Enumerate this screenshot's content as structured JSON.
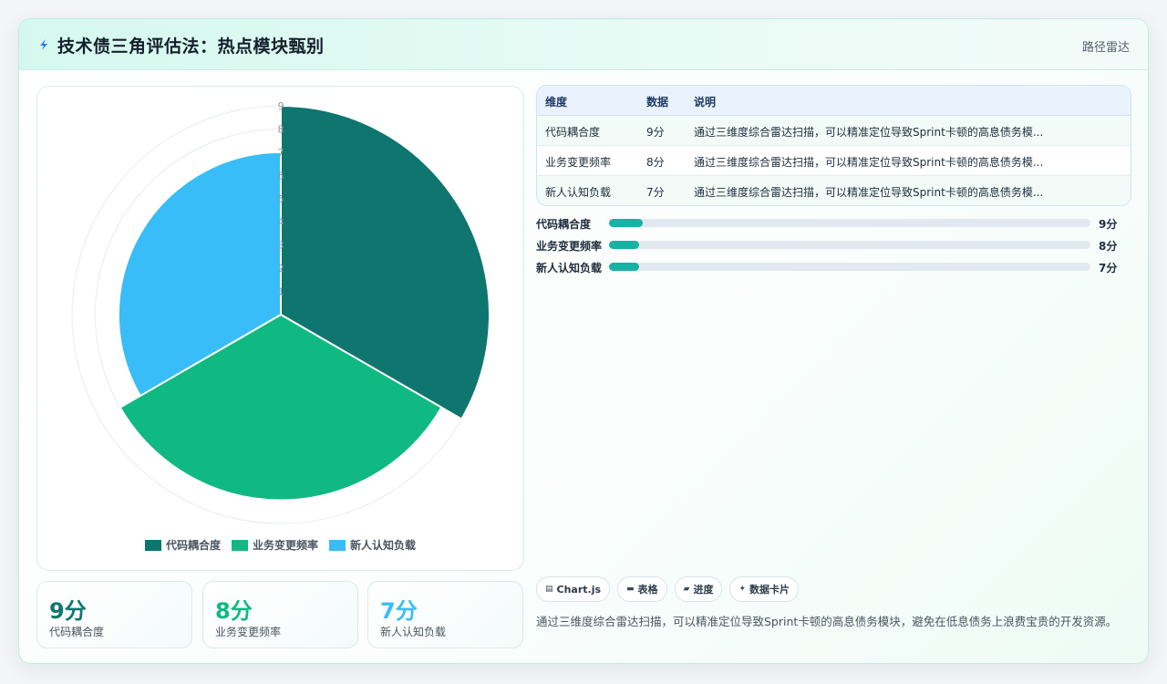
{
  "header": {
    "title": "技术债三角评估法：热点模块甄别",
    "link": "路径雷达",
    "bolt_color": "#2a7de1"
  },
  "chart_data": {
    "type": "polarArea",
    "categories": [
      "代码耦合度",
      "业务变更频率",
      "新人认知负载"
    ],
    "values": [
      9,
      8,
      7
    ],
    "colors": [
      "#0e766e",
      "#10b981",
      "#38bdf8"
    ],
    "rlim": [
      0,
      9
    ],
    "ticks": [
      1,
      2,
      3,
      4,
      5,
      6,
      7,
      8,
      9
    ],
    "legend_position": "bottom"
  },
  "stats": [
    {
      "value": "9分",
      "label": "代码耦合度",
      "color": "#0e766e"
    },
    {
      "value": "8分",
      "label": "业务变更频率",
      "color": "#10b981"
    },
    {
      "value": "7分",
      "label": "新人认知负载",
      "color": "#38bdf8"
    }
  ],
  "table": {
    "headers": [
      "维度",
      "数据",
      "说明"
    ],
    "rows": [
      [
        "代码耦合度",
        "9分",
        "通过三维度综合雷达扫描，可以精准定位导致Sprint卡顿的高息债务模..."
      ],
      [
        "业务变更频率",
        "8分",
        "通过三维度综合雷达扫描，可以精准定位导致Sprint卡顿的高息债务模..."
      ],
      [
        "新人认知负载",
        "7分",
        "通过三维度综合雷达扫描，可以精准定位导致Sprint卡顿的高息债务模..."
      ]
    ]
  },
  "progress": [
    {
      "label": "代码耦合度",
      "value": "9分",
      "fraction": 0.07
    },
    {
      "label": "业务变更频率",
      "value": "8分",
      "fraction": 0.063
    },
    {
      "label": "新人认知负载",
      "value": "7分",
      "fraction": 0.063
    }
  ],
  "tags": [
    {
      "icon": "chart-icon",
      "label": "Chart.js"
    },
    {
      "icon": "table-icon",
      "label": "表格"
    },
    {
      "icon": "progress-icon",
      "label": "进度"
    },
    {
      "icon": "sparkle-icon",
      "label": "数据卡片"
    }
  ],
  "description": "通过三维度综合雷达扫描，可以精准定位导致Sprint卡顿的高息债务模块，避免在低息债务上浪费宝贵的开发资源。"
}
